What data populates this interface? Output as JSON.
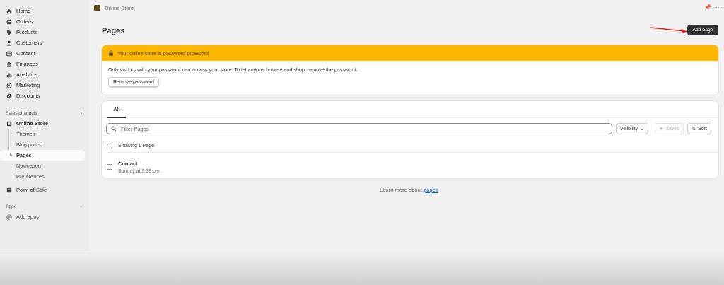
{
  "sidebar": {
    "main_items": [
      {
        "label": "Home",
        "icon": "home-icon"
      },
      {
        "label": "Orders",
        "icon": "orders-icon"
      },
      {
        "label": "Products",
        "icon": "tag-icon"
      },
      {
        "label": "Customers",
        "icon": "person-icon"
      },
      {
        "label": "Content",
        "icon": "content-icon"
      },
      {
        "label": "Finances",
        "icon": "bank-icon"
      },
      {
        "label": "Analytics",
        "icon": "chart-icon"
      },
      {
        "label": "Marketing",
        "icon": "target-icon"
      },
      {
        "label": "Discounts",
        "icon": "discount-icon"
      }
    ],
    "sales_channels_label": "Sales channels",
    "online_store": "Online Store",
    "sub_items": [
      "Themes",
      "Blog posts",
      "Pages",
      "Navigation",
      "Preferences"
    ],
    "active_sub": "Pages",
    "point_of_sale": "Point of Sale",
    "apps_label": "Apps",
    "add_apps": "Add apps"
  },
  "topbar": {
    "store_name": "Online Store"
  },
  "page": {
    "title": "Pages",
    "add_button": "Add page"
  },
  "banner": {
    "title": "Your online store is password protected",
    "body": "Only visitors with your password can access your store. To let anyone browse and shop, remove the password.",
    "button": "Remove password",
    "color": "#ffb800"
  },
  "list": {
    "tab": "All",
    "search_placeholder": "Filter Pages",
    "visibility_label": "Visibility",
    "saved_label": "Saved",
    "sort_label": "Sort",
    "showing": "Showing 1 Page",
    "rows": [
      {
        "title": "Contact",
        "subtitle": "Sunday at 5:39 pm"
      }
    ]
  },
  "footer": {
    "learn_prefix": "Learn more about",
    "learn_link": "pages"
  }
}
